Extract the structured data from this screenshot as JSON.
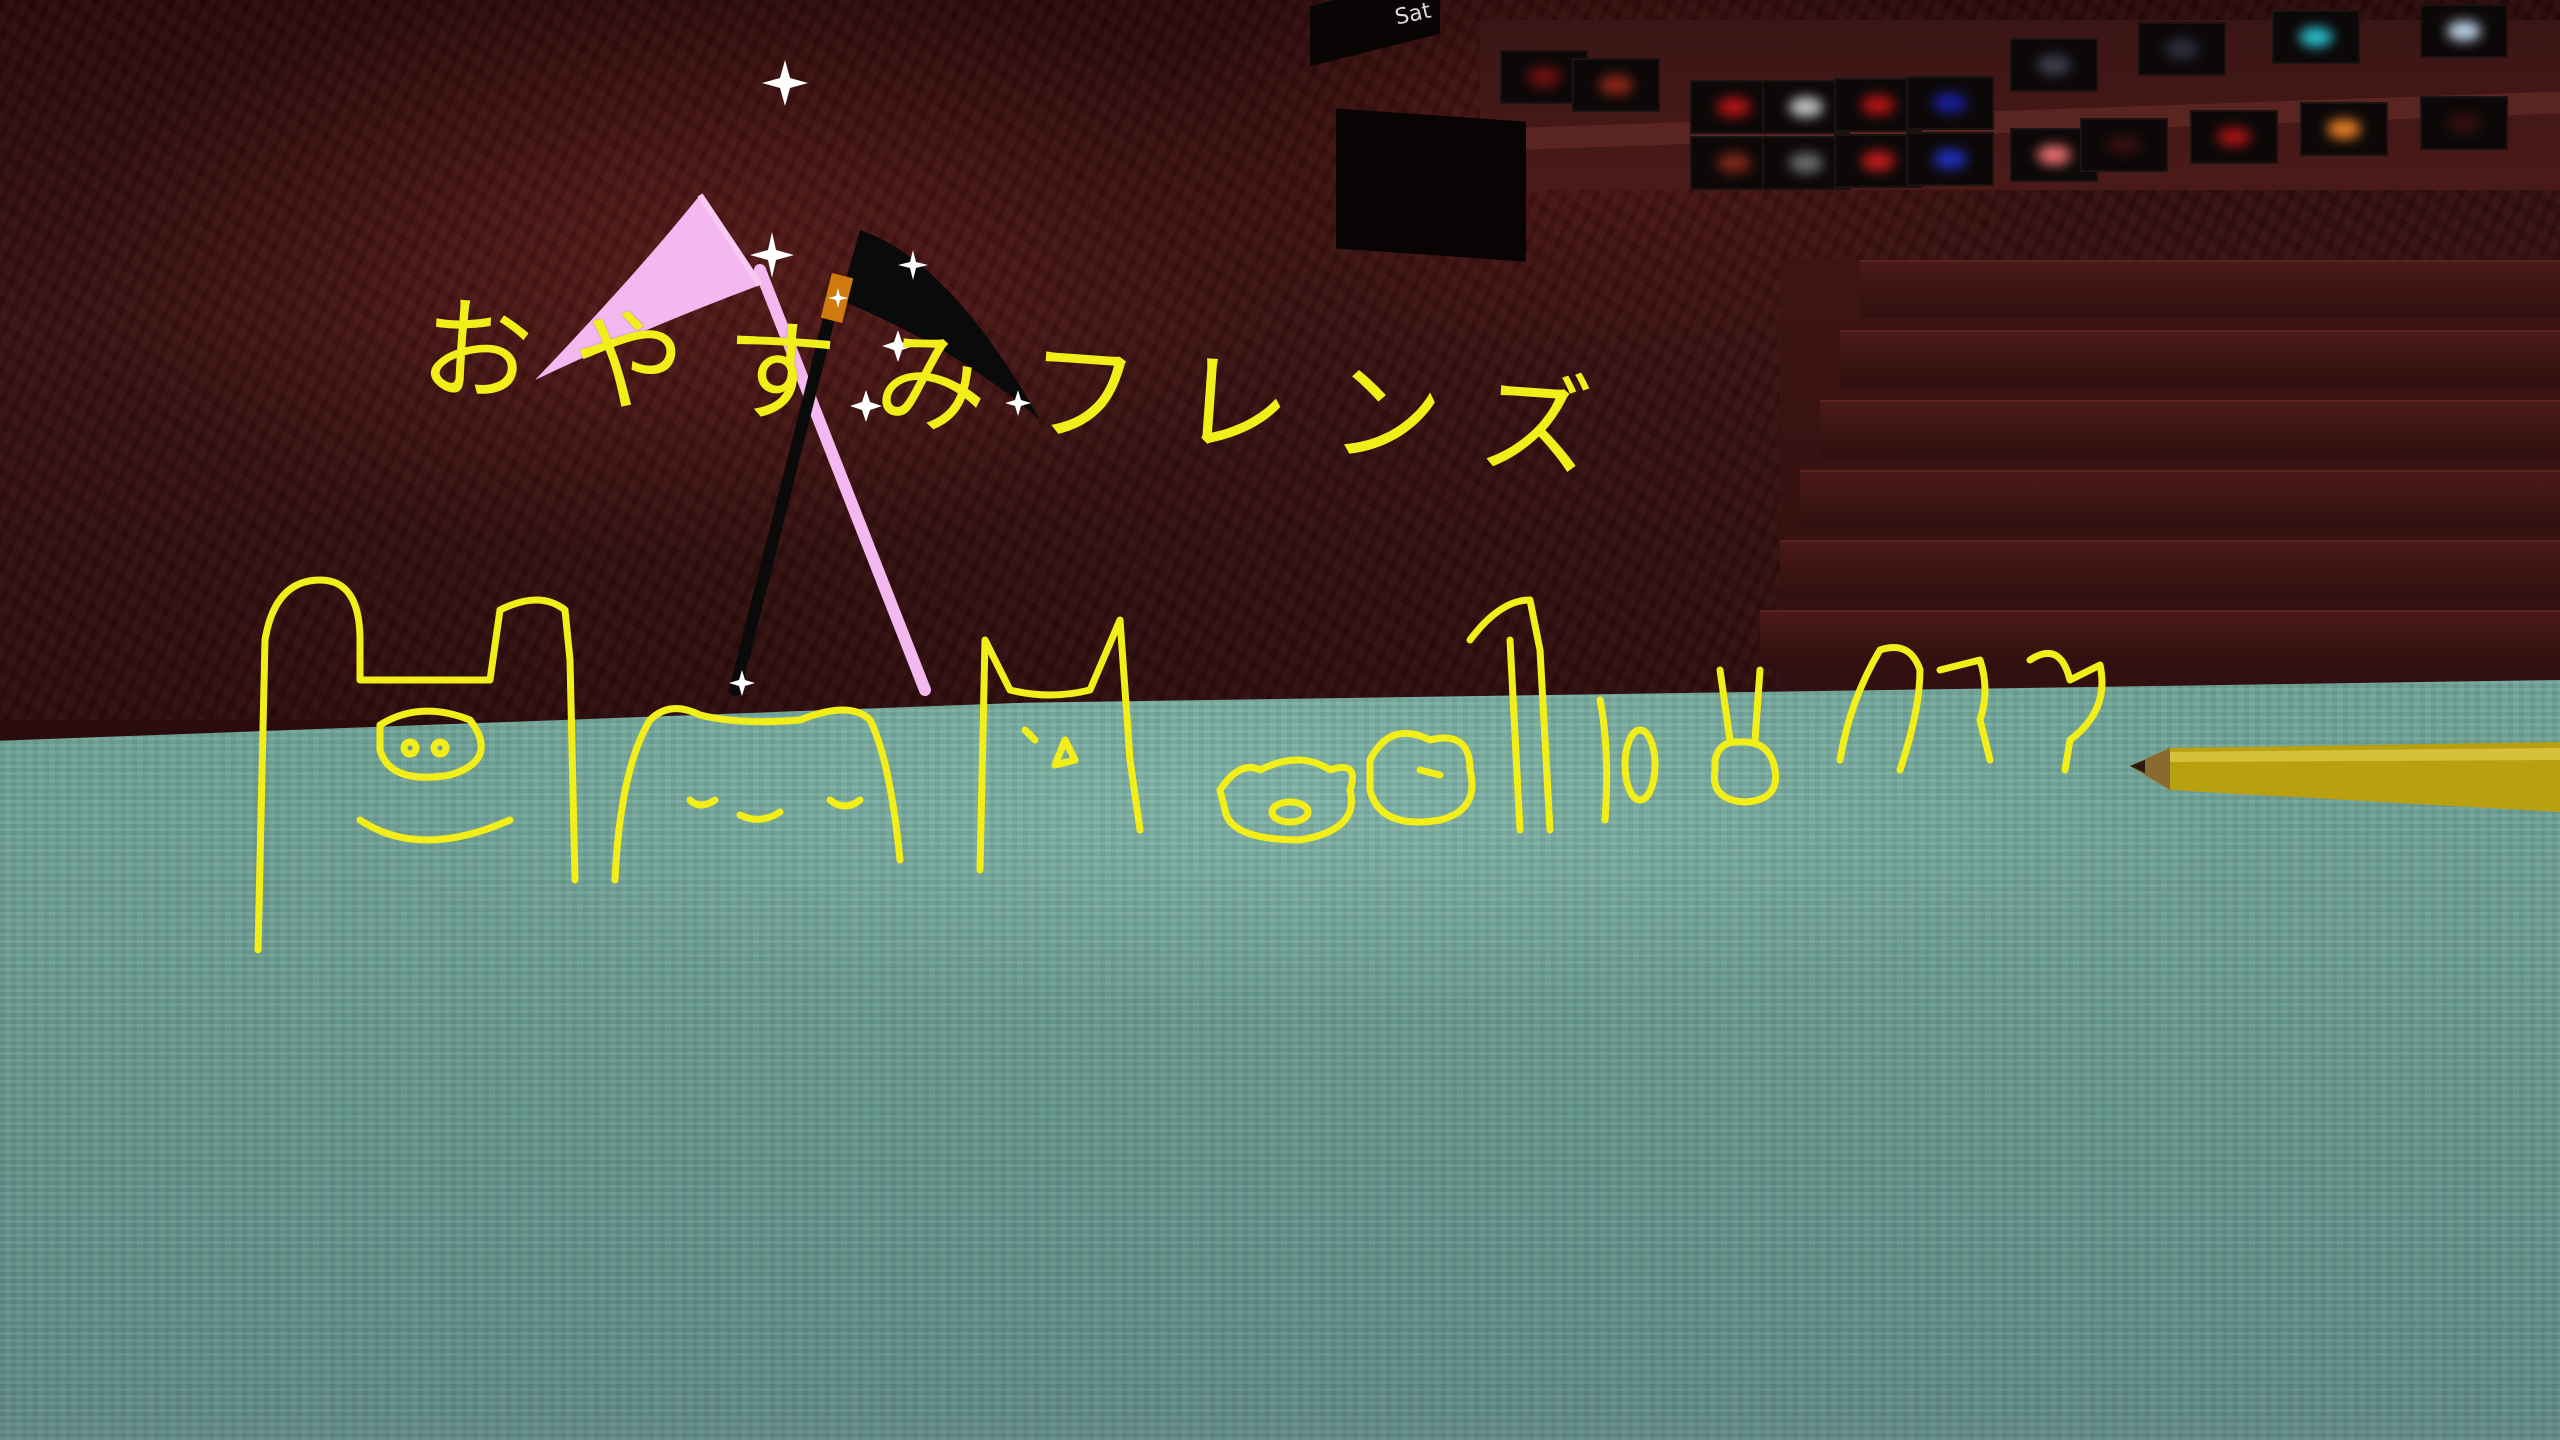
{
  "scene": {
    "description_free": true,
    "sky_sign": {
      "text": "Sat"
    },
    "drawing": {
      "caption": "おやすみフレンズ",
      "ink_color": "#f2ee1a"
    },
    "colors": {
      "wall": "#3a1212",
      "floor": "#6fa697",
      "scythe_pink": "#f4b8f0",
      "scythe_black": "#0a0a0a",
      "pencil": "#b8a010"
    },
    "icons": [
      "pink-scythe-icon",
      "black-scythe-icon",
      "sparkle-icon",
      "pencil-icon"
    ]
  }
}
